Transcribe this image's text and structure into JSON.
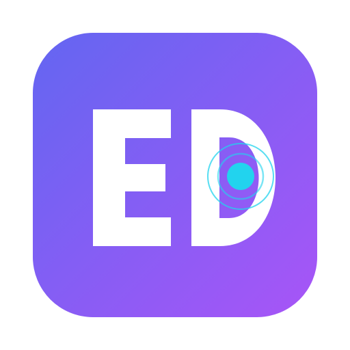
{
  "logo": {
    "letters": "ED",
    "gradient_start": "#6366F1",
    "gradient_end": "#A855F7",
    "letter_color": "#FFFFFF",
    "dot_color": "#22D3EE",
    "ring_color": "#22D3EE",
    "ring_shape": "concentric-signal-rings",
    "tile_shape": "rounded-square"
  }
}
